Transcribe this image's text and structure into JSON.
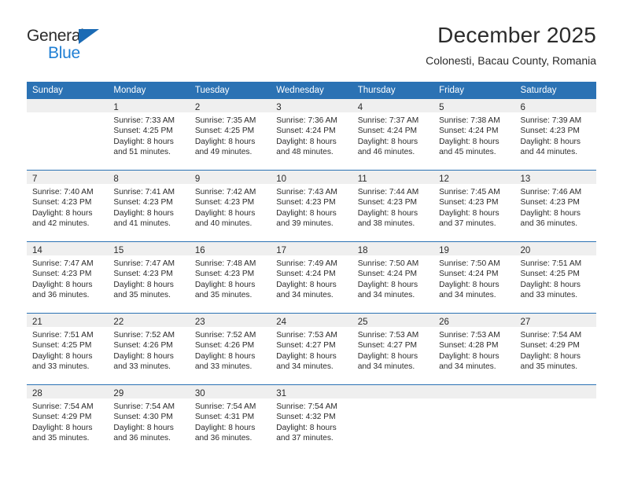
{
  "brand": {
    "name_part1": "General",
    "name_part2": "Blue",
    "color_dark": "#2b2b2b",
    "color_blue": "#1f7fd4",
    "triangle_color": "#1b6bb5"
  },
  "header": {
    "title": "December 2025",
    "subtitle": "Colonesti, Bacau County, Romania"
  },
  "theme": {
    "header_bar": "#2b72b4",
    "daynum_band": "#efefef",
    "text": "#2b2b2b",
    "cell_bg": "#ffffff"
  },
  "weekdays": [
    "Sunday",
    "Monday",
    "Tuesday",
    "Wednesday",
    "Thursday",
    "Friday",
    "Saturday"
  ],
  "weeks": [
    [
      {
        "day": "",
        "lines": []
      },
      {
        "day": "1",
        "lines": [
          "Sunrise: 7:33 AM",
          "Sunset: 4:25 PM",
          "Daylight: 8 hours",
          "and 51 minutes."
        ]
      },
      {
        "day": "2",
        "lines": [
          "Sunrise: 7:35 AM",
          "Sunset: 4:25 PM",
          "Daylight: 8 hours",
          "and 49 minutes."
        ]
      },
      {
        "day": "3",
        "lines": [
          "Sunrise: 7:36 AM",
          "Sunset: 4:24 PM",
          "Daylight: 8 hours",
          "and 48 minutes."
        ]
      },
      {
        "day": "4",
        "lines": [
          "Sunrise: 7:37 AM",
          "Sunset: 4:24 PM",
          "Daylight: 8 hours",
          "and 46 minutes."
        ]
      },
      {
        "day": "5",
        "lines": [
          "Sunrise: 7:38 AM",
          "Sunset: 4:24 PM",
          "Daylight: 8 hours",
          "and 45 minutes."
        ]
      },
      {
        "day": "6",
        "lines": [
          "Sunrise: 7:39 AM",
          "Sunset: 4:23 PM",
          "Daylight: 8 hours",
          "and 44 minutes."
        ]
      }
    ],
    [
      {
        "day": "7",
        "lines": [
          "Sunrise: 7:40 AM",
          "Sunset: 4:23 PM",
          "Daylight: 8 hours",
          "and 42 minutes."
        ]
      },
      {
        "day": "8",
        "lines": [
          "Sunrise: 7:41 AM",
          "Sunset: 4:23 PM",
          "Daylight: 8 hours",
          "and 41 minutes."
        ]
      },
      {
        "day": "9",
        "lines": [
          "Sunrise: 7:42 AM",
          "Sunset: 4:23 PM",
          "Daylight: 8 hours",
          "and 40 minutes."
        ]
      },
      {
        "day": "10",
        "lines": [
          "Sunrise: 7:43 AM",
          "Sunset: 4:23 PM",
          "Daylight: 8 hours",
          "and 39 minutes."
        ]
      },
      {
        "day": "11",
        "lines": [
          "Sunrise: 7:44 AM",
          "Sunset: 4:23 PM",
          "Daylight: 8 hours",
          "and 38 minutes."
        ]
      },
      {
        "day": "12",
        "lines": [
          "Sunrise: 7:45 AM",
          "Sunset: 4:23 PM",
          "Daylight: 8 hours",
          "and 37 minutes."
        ]
      },
      {
        "day": "13",
        "lines": [
          "Sunrise: 7:46 AM",
          "Sunset: 4:23 PM",
          "Daylight: 8 hours",
          "and 36 minutes."
        ]
      }
    ],
    [
      {
        "day": "14",
        "lines": [
          "Sunrise: 7:47 AM",
          "Sunset: 4:23 PM",
          "Daylight: 8 hours",
          "and 36 minutes."
        ]
      },
      {
        "day": "15",
        "lines": [
          "Sunrise: 7:47 AM",
          "Sunset: 4:23 PM",
          "Daylight: 8 hours",
          "and 35 minutes."
        ]
      },
      {
        "day": "16",
        "lines": [
          "Sunrise: 7:48 AM",
          "Sunset: 4:23 PM",
          "Daylight: 8 hours",
          "and 35 minutes."
        ]
      },
      {
        "day": "17",
        "lines": [
          "Sunrise: 7:49 AM",
          "Sunset: 4:24 PM",
          "Daylight: 8 hours",
          "and 34 minutes."
        ]
      },
      {
        "day": "18",
        "lines": [
          "Sunrise: 7:50 AM",
          "Sunset: 4:24 PM",
          "Daylight: 8 hours",
          "and 34 minutes."
        ]
      },
      {
        "day": "19",
        "lines": [
          "Sunrise: 7:50 AM",
          "Sunset: 4:24 PM",
          "Daylight: 8 hours",
          "and 34 minutes."
        ]
      },
      {
        "day": "20",
        "lines": [
          "Sunrise: 7:51 AM",
          "Sunset: 4:25 PM",
          "Daylight: 8 hours",
          "and 33 minutes."
        ]
      }
    ],
    [
      {
        "day": "21",
        "lines": [
          "Sunrise: 7:51 AM",
          "Sunset: 4:25 PM",
          "Daylight: 8 hours",
          "and 33 minutes."
        ]
      },
      {
        "day": "22",
        "lines": [
          "Sunrise: 7:52 AM",
          "Sunset: 4:26 PM",
          "Daylight: 8 hours",
          "and 33 minutes."
        ]
      },
      {
        "day": "23",
        "lines": [
          "Sunrise: 7:52 AM",
          "Sunset: 4:26 PM",
          "Daylight: 8 hours",
          "and 33 minutes."
        ]
      },
      {
        "day": "24",
        "lines": [
          "Sunrise: 7:53 AM",
          "Sunset: 4:27 PM",
          "Daylight: 8 hours",
          "and 34 minutes."
        ]
      },
      {
        "day": "25",
        "lines": [
          "Sunrise: 7:53 AM",
          "Sunset: 4:27 PM",
          "Daylight: 8 hours",
          "and 34 minutes."
        ]
      },
      {
        "day": "26",
        "lines": [
          "Sunrise: 7:53 AM",
          "Sunset: 4:28 PM",
          "Daylight: 8 hours",
          "and 34 minutes."
        ]
      },
      {
        "day": "27",
        "lines": [
          "Sunrise: 7:54 AM",
          "Sunset: 4:29 PM",
          "Daylight: 8 hours",
          "and 35 minutes."
        ]
      }
    ],
    [
      {
        "day": "28",
        "lines": [
          "Sunrise: 7:54 AM",
          "Sunset: 4:29 PM",
          "Daylight: 8 hours",
          "and 35 minutes."
        ]
      },
      {
        "day": "29",
        "lines": [
          "Sunrise: 7:54 AM",
          "Sunset: 4:30 PM",
          "Daylight: 8 hours",
          "and 36 minutes."
        ]
      },
      {
        "day": "30",
        "lines": [
          "Sunrise: 7:54 AM",
          "Sunset: 4:31 PM",
          "Daylight: 8 hours",
          "and 36 minutes."
        ]
      },
      {
        "day": "31",
        "lines": [
          "Sunrise: 7:54 AM",
          "Sunset: 4:32 PM",
          "Daylight: 8 hours",
          "and 37 minutes."
        ]
      },
      {
        "day": "",
        "lines": []
      },
      {
        "day": "",
        "lines": []
      },
      {
        "day": "",
        "lines": []
      }
    ]
  ]
}
